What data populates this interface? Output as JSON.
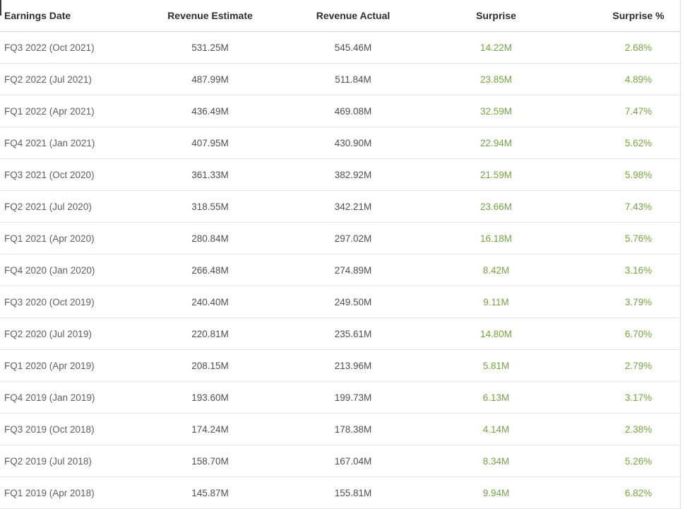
{
  "table": {
    "columns": [
      "Earnings Date",
      "Revenue Estimate",
      "Revenue Actual",
      "Surprise",
      "Surprise %"
    ],
    "rows": [
      {
        "date": "FQ3 2022 (Oct 2021)",
        "estimate": "531.25M",
        "actual": "545.46M",
        "surprise": "14.22M",
        "surprise_pct": "2.68%"
      },
      {
        "date": "FQ2 2022 (Jul 2021)",
        "estimate": "487.99M",
        "actual": "511.84M",
        "surprise": "23.85M",
        "surprise_pct": "4.89%"
      },
      {
        "date": "FQ1 2022 (Apr 2021)",
        "estimate": "436.49M",
        "actual": "469.08M",
        "surprise": "32.59M",
        "surprise_pct": "7.47%"
      },
      {
        "date": "FQ4 2021 (Jan 2021)",
        "estimate": "407.95M",
        "actual": "430.90M",
        "surprise": "22.94M",
        "surprise_pct": "5.62%"
      },
      {
        "date": "FQ3 2021 (Oct 2020)",
        "estimate": "361.33M",
        "actual": "382.92M",
        "surprise": "21.59M",
        "surprise_pct": "5.98%"
      },
      {
        "date": "FQ2 2021 (Jul 2020)",
        "estimate": "318.55M",
        "actual": "342.21M",
        "surprise": "23.66M",
        "surprise_pct": "7.43%"
      },
      {
        "date": "FQ1 2021 (Apr 2020)",
        "estimate": "280.84M",
        "actual": "297.02M",
        "surprise": "16.18M",
        "surprise_pct": "5.76%"
      },
      {
        "date": "FQ4 2020 (Jan 2020)",
        "estimate": "266.48M",
        "actual": "274.89M",
        "surprise": "8.42M",
        "surprise_pct": "3.16%"
      },
      {
        "date": "FQ3 2020 (Oct 2019)",
        "estimate": "240.40M",
        "actual": "249.50M",
        "surprise": "9.11M",
        "surprise_pct": "3.79%"
      },
      {
        "date": "FQ2 2020 (Jul 2019)",
        "estimate": "220.81M",
        "actual": "235.61M",
        "surprise": "14.80M",
        "surprise_pct": "6.70%"
      },
      {
        "date": "FQ1 2020 (Apr 2019)",
        "estimate": "208.15M",
        "actual": "213.96M",
        "surprise": "5.81M",
        "surprise_pct": "2.79%"
      },
      {
        "date": "FQ4 2019 (Jan 2019)",
        "estimate": "193.60M",
        "actual": "199.73M",
        "surprise": "6.13M",
        "surprise_pct": "3.17%"
      },
      {
        "date": "FQ3 2019 (Oct 2018)",
        "estimate": "174.24M",
        "actual": "178.38M",
        "surprise": "4.14M",
        "surprise_pct": "2.38%"
      },
      {
        "date": "FQ2 2019 (Jul 2018)",
        "estimate": "158.70M",
        "actual": "167.04M",
        "surprise": "8.34M",
        "surprise_pct": "5.26%"
      },
      {
        "date": "FQ1 2019 (Apr 2018)",
        "estimate": "145.87M",
        "actual": "155.81M",
        "surprise": "9.94M",
        "surprise_pct": "6.82%"
      }
    ],
    "colors": {
      "positive_green": "#73a53c",
      "header_text": "#2e2e2e",
      "row_label_text": "#606060",
      "value_text": "#4f4f4f",
      "row_border": "#e5e5e5",
      "header_border": "#d4d4d4",
      "table_right_border": "#e0e0e0"
    }
  }
}
